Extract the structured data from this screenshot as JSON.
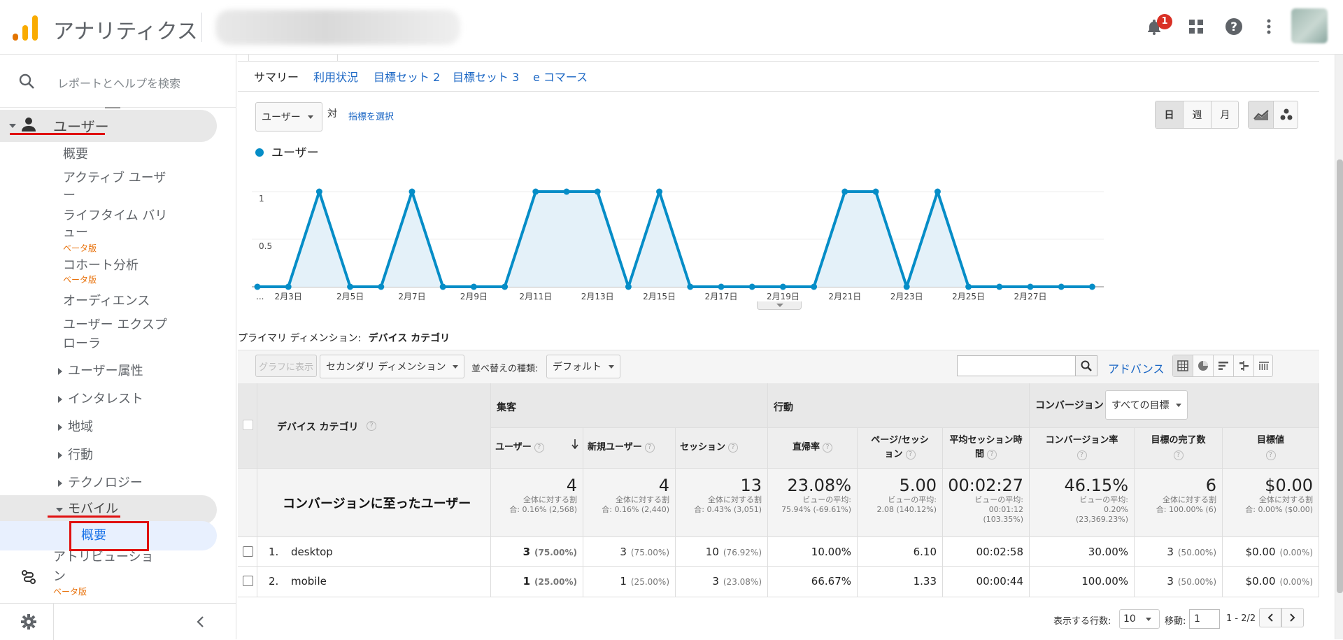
{
  "app": {
    "title": "アナリティクス",
    "notification_count": "1"
  },
  "sidebar": {
    "search_placeholder": "レポートとヘルプを検索",
    "users_label": "ユーザー",
    "items": [
      {
        "label": "概要"
      },
      {
        "label": "アクティブ ユーザ",
        "label2": "ー"
      },
      {
        "label": "ライフタイム バリ",
        "label2": "ュー",
        "badge": "ベータ版"
      },
      {
        "label": "コホート分析",
        "badge": "ベータ版"
      },
      {
        "label": "オーディエンス"
      },
      {
        "label": "ユーザー エクスプ",
        "label2": "ローラ"
      }
    ],
    "groups": [
      "ユーザー属性",
      "インタレスト",
      "地域",
      "行動",
      "テクノロジー"
    ],
    "mobile_label": "モバイル",
    "mobile_child": "概要",
    "attribution_label": "アトリビューショ",
    "attribution_label2": "ン",
    "attribution_badge": "ベータ版"
  },
  "tabs": [
    "サマリー",
    "利用状況",
    "目標セット 2",
    "目標セット 3",
    "e コマース"
  ],
  "chart_controls": {
    "metric": "ユーザー",
    "vs": "対",
    "select_metric": "指標を選択",
    "periods": [
      "日",
      "週",
      "月"
    ]
  },
  "chart_data": {
    "type": "area",
    "series": [
      {
        "name": "ユーザー",
        "values": [
          0,
          0,
          1,
          0,
          0,
          1,
          0,
          0,
          0,
          1,
          1,
          1,
          0,
          1,
          0,
          0,
          0,
          0,
          0,
          1,
          1,
          0,
          1,
          0,
          0,
          0,
          0,
          0
        ]
      }
    ],
    "x_tick_labels": [
      "...",
      "2月3日",
      "2月5日",
      "2月7日",
      "2月9日",
      "2月11日",
      "2月13日",
      "2月15日",
      "2月17日",
      "2月19日",
      "2月21日",
      "2月23日",
      "2月25日",
      "2月27日"
    ],
    "y_tick_labels": [
      "1",
      "0.5"
    ],
    "ylim": [
      0,
      1
    ],
    "color": "#058dc7",
    "fill": "#e4f1f9"
  },
  "dimension": {
    "label": "プライマリ ディメンション:",
    "value": "デバイス カテゴリ"
  },
  "toolbar": {
    "plot_rows": "グラフに表示",
    "secondary_dimension": "セカンダリ ディメンション",
    "sort_label": "並べ替えの種類:",
    "sort_value": "デフォルト",
    "advanced": "アドバンス"
  },
  "table": {
    "dim_header": "デバイス カテゴリ",
    "groups": [
      "集客",
      "行動",
      "コンバージョン"
    ],
    "goal_select": "すべての目標",
    "columns": [
      "ユーザー",
      "新規ユーザー",
      "セッション",
      "直帰率",
      "ページ/セッション",
      "平均セッション時間",
      "コンバージョン率",
      "目標の完了数",
      "目標値"
    ],
    "columns_line2": [
      "",
      "",
      "",
      "",
      "ョン",
      "間",
      "",
      "",
      ""
    ],
    "columns_line1": [
      "",
      "",
      "",
      "",
      "ページ/セッシ",
      "平均セッション時",
      "",
      "",
      ""
    ],
    "segment_label": "コンバージョンに至ったユーザー",
    "totals": [
      {
        "value": "4",
        "sub1": "全体に対する割",
        "sub2": "合: 0.16% (2,568)",
        "sub3": ""
      },
      {
        "value": "4",
        "sub1": "全体に対する割",
        "sub2": "合: 0.16% (2,440)",
        "sub3": ""
      },
      {
        "value": "13",
        "sub1": "全体に対する割",
        "sub2": "合: 0.43% (3,051)",
        "sub3": ""
      },
      {
        "value": "23.08%",
        "sub1": "ビューの平均:",
        "sub2": "75.94% (-69.61%)",
        "sub3": ""
      },
      {
        "value": "5.00",
        "sub1": "ビューの平均:",
        "sub2": "2.08 (140.12%)",
        "sub3": ""
      },
      {
        "value": "00:02:27",
        "sub1": "ビューの平均:",
        "sub2": "00:01:12",
        "sub3": "(103.35%)"
      },
      {
        "value": "46.15%",
        "sub1": "ビューの平均:",
        "sub2": "0.20%",
        "sub3": "(23,369.23%)"
      },
      {
        "value": "6",
        "sub1": "全体に対する割",
        "sub2": "合: 100.00% (6)",
        "sub3": ""
      },
      {
        "value": "$0.00",
        "sub1": "全体に対する割",
        "sub2": "合: 0.00% ($0.00)",
        "sub3": ""
      }
    ],
    "rows": [
      {
        "index": "1.",
        "name": "desktop",
        "cells": [
          {
            "v": "3",
            "p": "(75.00%)"
          },
          {
            "v": "3",
            "p": "(75.00%)"
          },
          {
            "v": "10",
            "p": "(76.92%)"
          },
          {
            "v": "10.00%",
            "p": ""
          },
          {
            "v": "6.10",
            "p": ""
          },
          {
            "v": "00:02:58",
            "p": ""
          },
          {
            "v": "30.00%",
            "p": ""
          },
          {
            "v": "3",
            "p": "(50.00%)"
          },
          {
            "v": "$0.00",
            "p": "(0.00%)"
          }
        ]
      },
      {
        "index": "2.",
        "name": "mobile",
        "cells": [
          {
            "v": "1",
            "p": "(25.00%)"
          },
          {
            "v": "1",
            "p": "(25.00%)"
          },
          {
            "v": "3",
            "p": "(23.08%)"
          },
          {
            "v": "66.67%",
            "p": ""
          },
          {
            "v": "1.33",
            "p": ""
          },
          {
            "v": "00:00:44",
            "p": ""
          },
          {
            "v": "100.00%",
            "p": ""
          },
          {
            "v": "3",
            "p": "(50.00%)"
          },
          {
            "v": "$0.00",
            "p": "(0.00%)"
          }
        ]
      }
    ]
  },
  "pagination": {
    "rows_label": "表示する行数:",
    "rows_value": "10",
    "goto_label": "移動:",
    "goto_value": "1",
    "range": "1 - 2/2"
  }
}
